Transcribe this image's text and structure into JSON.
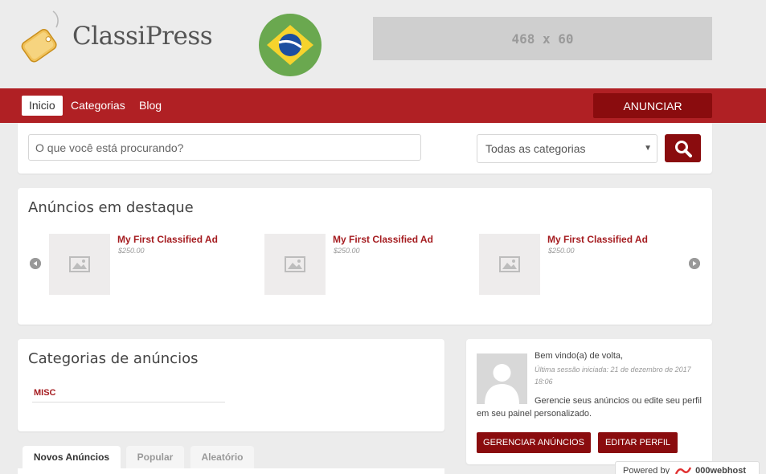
{
  "header": {
    "logo_text": "ClassiPress",
    "banner_text": "468 x 60"
  },
  "nav": {
    "items": [
      {
        "label": "Inicio",
        "active": true
      },
      {
        "label": "Categorias",
        "active": false
      },
      {
        "label": "Blog",
        "active": false
      }
    ],
    "post_button": "ANUNCIAR"
  },
  "search": {
    "placeholder": "O que você está procurando?",
    "category_selected": "Todas as categorias"
  },
  "featured": {
    "title": "Anúncios em destaque",
    "items": [
      {
        "title": "My First Classified Ad",
        "price": "$250.00"
      },
      {
        "title": "My First Classified Ad",
        "price": "$250.00"
      },
      {
        "title": "My First Classified Ad",
        "price": "$250.00"
      }
    ]
  },
  "categories": {
    "title": "Categorias de anúncios",
    "items": [
      "MISC"
    ]
  },
  "tabs": [
    {
      "label": "Novos Anúncios",
      "active": true
    },
    {
      "label": "Popular",
      "active": false
    },
    {
      "label": "Aleatório",
      "active": false
    }
  ],
  "welcome": {
    "greeting": "Bem vindo(a) de volta,",
    "last_login": "Última sessão iniciada: 21 de dezembro de 2017 18:06",
    "manage_text": "Gerencie seus anúncios ou edite seu perfil em seu painel personalizado.",
    "manage_button": "GERENCIAR ANÚNCIOS",
    "edit_button": "EDITAR PERFIL"
  },
  "powered": {
    "label": "Powered by",
    "brand": "000webhost"
  },
  "colors": {
    "primary_red": "#b02024",
    "dark_red": "#8a0c0e",
    "link_red": "#a51c20"
  }
}
